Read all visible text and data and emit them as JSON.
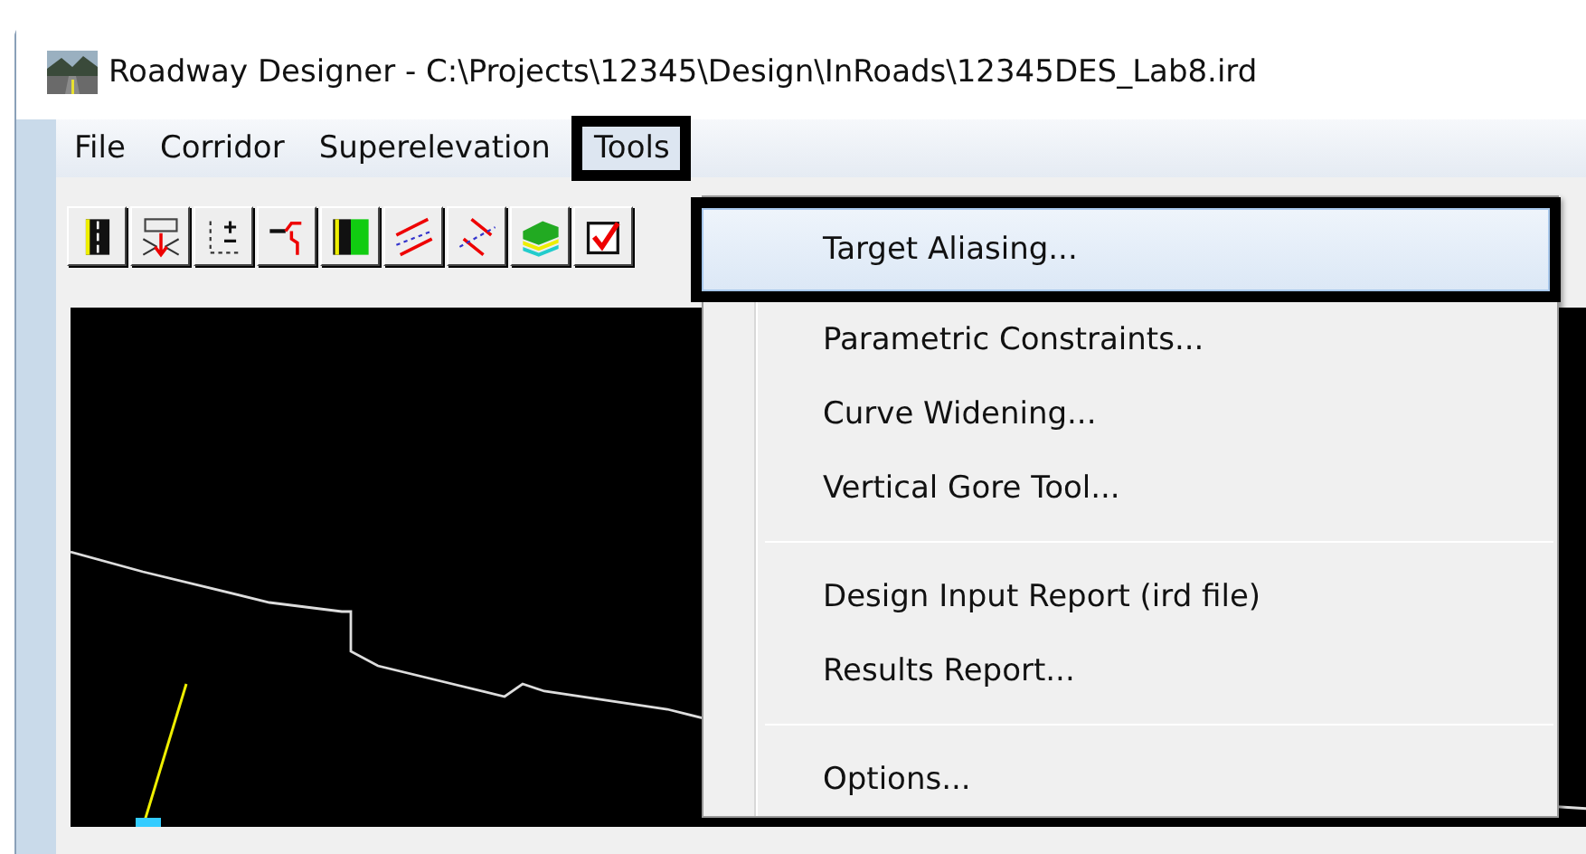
{
  "window": {
    "title": "Roadway Designer - C:\\Projects\\12345\\Design\\InRoads\\12345DES_Lab8.ird"
  },
  "menu_bar": [
    {
      "label": "File",
      "selected": false
    },
    {
      "label": "Corridor",
      "selected": false
    },
    {
      "label": "Superelevation",
      "selected": false
    },
    {
      "label": "Tools",
      "selected": true
    }
  ],
  "toolbar": [
    {
      "kind": "road"
    },
    {
      "kind": "station"
    },
    {
      "kind": "points"
    },
    {
      "kind": "template"
    },
    {
      "kind": "roadgreen"
    },
    {
      "kind": "lines"
    },
    {
      "kind": "transition"
    },
    {
      "kind": "layers"
    },
    {
      "kind": "check"
    }
  ],
  "tools_menu": [
    {
      "kind": "item",
      "label": "Target Aliasing...",
      "selected": true
    },
    {
      "kind": "item",
      "label": "Parametric Constraints...",
      "selected": false
    },
    {
      "kind": "item",
      "label": "Curve Widening...",
      "selected": false
    },
    {
      "kind": "item",
      "label": "Vertical Gore Tool...",
      "selected": false
    },
    {
      "kind": "separator"
    },
    {
      "kind": "item",
      "label": "Design Input Report (ird file)",
      "selected": false
    },
    {
      "kind": "item",
      "label": "Results Report...",
      "selected": false
    },
    {
      "kind": "separator"
    },
    {
      "kind": "item",
      "label": "Options...",
      "selected": false
    }
  ]
}
